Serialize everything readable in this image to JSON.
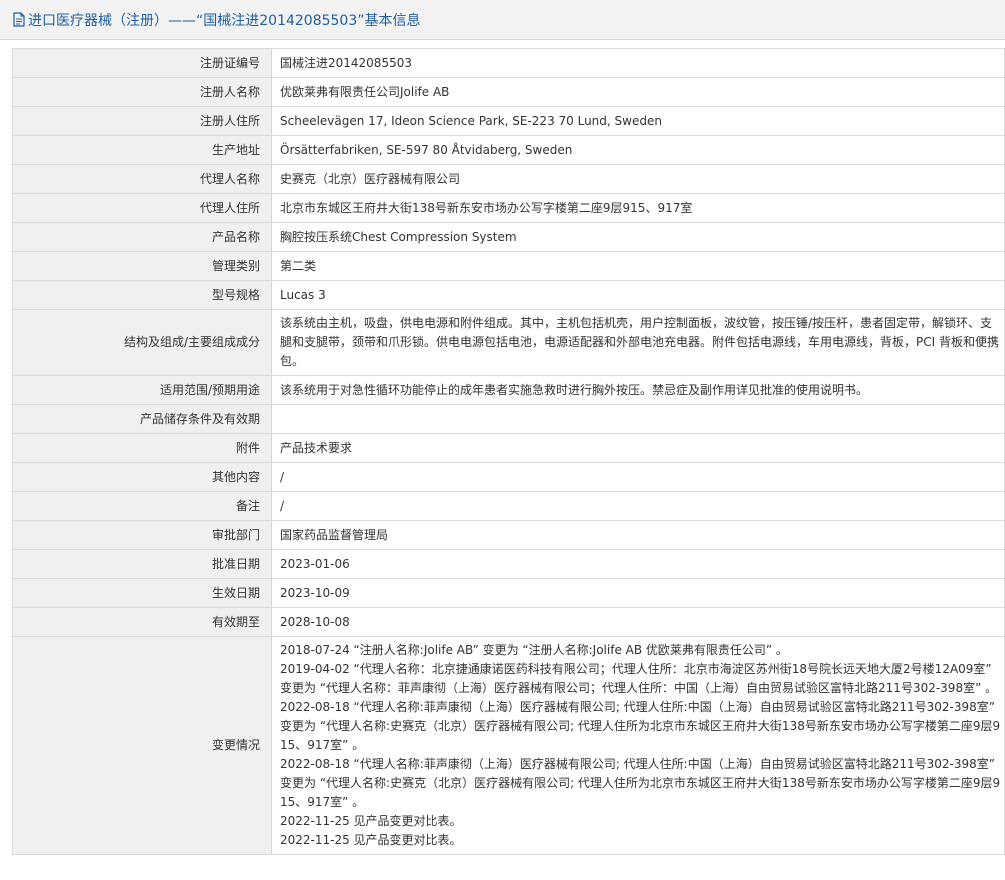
{
  "page": {
    "title": "进口医疗器械（注册）——“国械注进20142085503”基本信息"
  },
  "rows": [
    {
      "label": "注册证编号",
      "value": "国械注进20142085503"
    },
    {
      "label": "注册人名称",
      "value": "优欧莱弗有限责任公司Jolife AB"
    },
    {
      "label": "注册人住所",
      "value": "Scheelevägen 17, Ideon Science Park, SE-223 70 Lund, Sweden"
    },
    {
      "label": "生产地址",
      "value": "Örsätterfabriken, SE-597 80 Åtvidaberg, Sweden"
    },
    {
      "label": "代理人名称",
      "value": "史赛克（北京）医疗器械有限公司"
    },
    {
      "label": "代理人住所",
      "value": "北京市东城区王府井大街138号新东安市场办公写字楼第二座9层915、917室"
    },
    {
      "label": "产品名称",
      "value": "胸腔按压系统Chest Compression System"
    },
    {
      "label": "管理类别",
      "value": "第二类"
    },
    {
      "label": "型号规格",
      "value": "Lucas 3"
    },
    {
      "label": "结构及组成/主要组成成分",
      "value": "该系统由主机，吸盘，供电电源和附件组成。其中，主机包括机壳，用户控制面板，波纹管，按压锤/按压杆，患者固定带，解锁环、支腿和支腿带，颈带和爪形锁。供电电源包括电池，电源适配器和外部电池充电器。附件包括电源线，车用电源线，背板，PCI 背板和便携包。"
    },
    {
      "label": "适用范围/预期用途",
      "value": "该系统用于对急性循环功能停止的成年患者实施急救时进行胸外按压。禁忌症及副作用详见批准的使用说明书。"
    },
    {
      "label": "产品储存条件及有效期",
      "value": ""
    },
    {
      "label": "附件",
      "value": "产品技术要求"
    },
    {
      "label": "其他内容",
      "value": "/"
    },
    {
      "label": "备注",
      "value": "/"
    },
    {
      "label": "审批部门",
      "value": "国家药品监督管理局"
    },
    {
      "label": "批准日期",
      "value": "2023-01-06"
    },
    {
      "label": "生效日期",
      "value": "2023-10-09"
    },
    {
      "label": "有效期至",
      "value": "2028-10-08"
    }
  ],
  "changes": {
    "label": "变更情况",
    "entries": [
      "2018-07-24  “注册人名称:Jolife AB” 变更为 “注册人名称:Jolife AB 优欧莱弗有限责任公司” 。",
      "2019-04-02  “代理人名称：北京捷通康诺医药科技有限公司；代理人住所：北京市海淀区苏州街18号院长远天地大厦2号楼12A09室” 变更为 “代理人名称：菲声康彻（上海）医疗器械有限公司；代理人住所：中国（上海）自由贸易试验区富特北路211号302-398室” 。",
      "2022-08-18  “代理人名称:菲声康彻（上海）医疗器械有限公司; 代理人住所:中国（上海）自由贸易试验区富特北路211号302-398室” 变更为 “代理人名称:史赛克（北京）医疗器械有限公司; 代理人住所为北京市东城区王府井大街138号新东安市场办公写字楼第二座9层915、917室” 。",
      "2022-08-18  “代理人名称:菲声康彻（上海）医疗器械有限公司; 代理人住所:中国（上海）自由贸易试验区富特北路211号302-398室” 变更为 “代理人名称:史赛克（北京）医疗器械有限公司; 代理人住所为北京市东城区王府井大街138号新东安市场办公写字楼第二座9层915、917室” 。",
      "2022-11-25 见产品变更对比表。",
      "2022-11-25 见产品变更对比表。"
    ]
  }
}
